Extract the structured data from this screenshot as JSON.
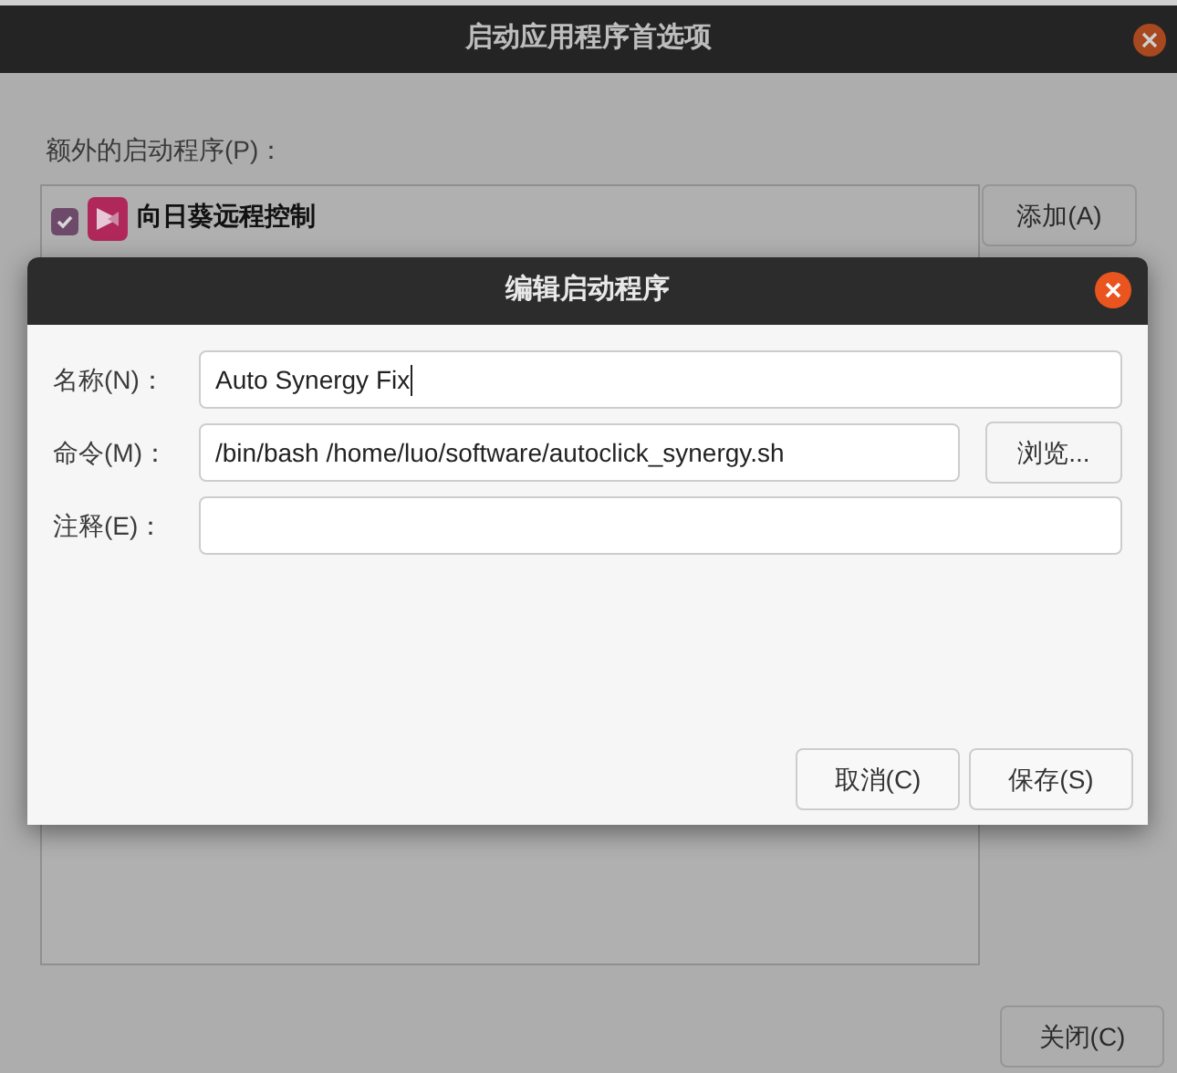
{
  "window": {
    "title": "启动应用程序首选项"
  },
  "list_label": "额外的启动程序(P)：",
  "entries": [
    {
      "name": "向日葵远程控制",
      "checked": true
    }
  ],
  "side_buttons": [
    "添加(A)"
  ],
  "close_button": "关闭(C)",
  "dialog": {
    "title": "编辑启动程序",
    "fields": [
      {
        "label": "名称(N)：",
        "value": "Auto Synergy Fix",
        "focused": true
      },
      {
        "label": "命令(M)：",
        "value": "/bin/bash /home/luo/software/autoclick_synergy.sh",
        "button": "浏览..."
      },
      {
        "label": "注释(E)："
      }
    ],
    "buttons": [
      "取消(C)",
      "保存(S)"
    ]
  }
}
